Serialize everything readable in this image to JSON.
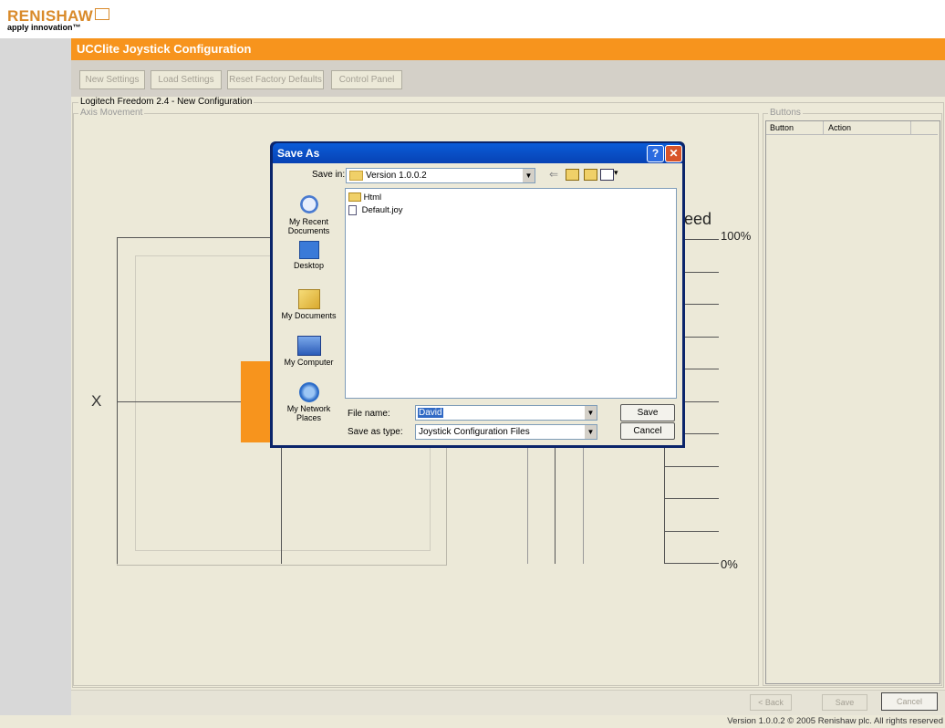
{
  "brand": {
    "name": "RENISHAW",
    "tagline": "apply innovation™"
  },
  "app": {
    "title": "UCClite Joystick Configuration"
  },
  "toolbar": {
    "new": "New Settings",
    "load": "Load Settings",
    "reset": "Reset Factory Defaults",
    "control": "Control Panel"
  },
  "config": {
    "title": "Logitech Freedom 2.4 - New Configuration",
    "axis_legend": "Axis Movement",
    "axis_x": "X",
    "speed_partial": "eed",
    "pct_high": "100%",
    "pct_low": "0%"
  },
  "buttons_panel": {
    "legend": "Buttons",
    "col_button": "Button",
    "col_action": "Action"
  },
  "dialog": {
    "title": "Save As",
    "help": "?",
    "close": "✕",
    "save_in_label": "Save in:",
    "save_in_value": "Version 1.0.0.2",
    "places": [
      "My Recent Documents",
      "Desktop",
      "My Documents",
      "My Computer",
      "My Network Places"
    ],
    "files": [
      {
        "name": "Html",
        "icon": "folder-icon"
      },
      {
        "name": "Default.joy",
        "icon": "file-icon"
      }
    ],
    "file_name_label": "File name:",
    "file_name_value": "David",
    "save_as_type_label": "Save as type:",
    "save_as_type_value": "Joystick Configuration Files",
    "save": "Save",
    "cancel": "Cancel"
  },
  "nav": {
    "back": "< Back",
    "save": "Save",
    "cancel": "Cancel"
  },
  "footer": {
    "version": "Version 1.0.0.2 © 2005 Renishaw plc. All rights reserved"
  },
  "colors": {
    "accent": "#f7941d",
    "dialog_title": "#0842b4",
    "panel": "#ece9d8"
  }
}
